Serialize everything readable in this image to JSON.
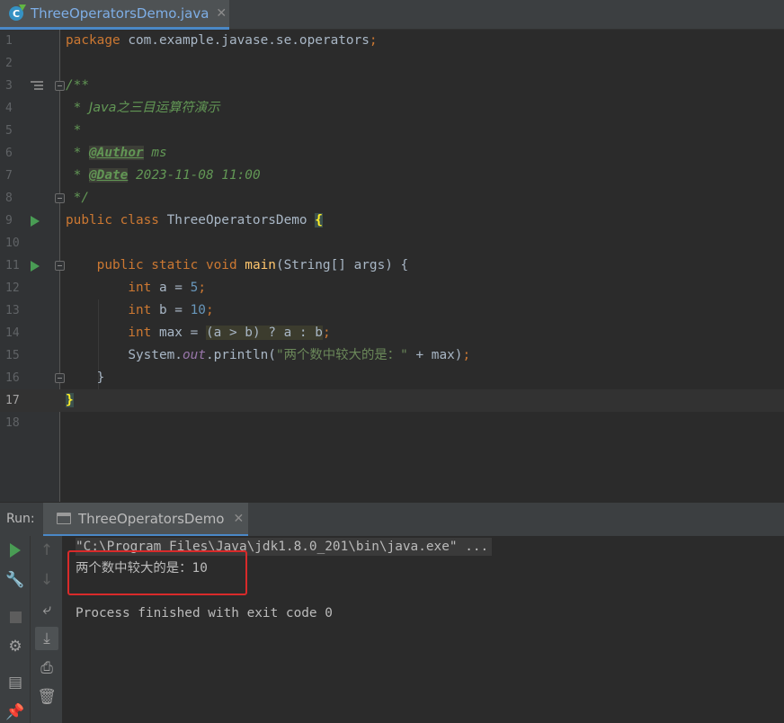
{
  "editor": {
    "tab": {
      "title": "ThreeOperatorsDemo.java",
      "icon": "java-class-icon",
      "close": "✕"
    },
    "current_line": 17,
    "lines": [
      {
        "n": "1"
      },
      {
        "n": "2"
      },
      {
        "n": "3"
      },
      {
        "n": "4"
      },
      {
        "n": "5"
      },
      {
        "n": "6"
      },
      {
        "n": "7"
      },
      {
        "n": "8"
      },
      {
        "n": "9"
      },
      {
        "n": "10"
      },
      {
        "n": "11"
      },
      {
        "n": "12"
      },
      {
        "n": "13"
      },
      {
        "n": "14"
      },
      {
        "n": "15"
      },
      {
        "n": "16"
      },
      {
        "n": "17"
      },
      {
        "n": "18"
      }
    ],
    "code": {
      "l1_kw": "package",
      "l1_rest": " com.example.javase.se.operators",
      "l1_semi": ";",
      "l3": "/**",
      "l4_star": " * ",
      "l4_text": "Java之三目运算符演示",
      "l5": " *",
      "l6_star": " * ",
      "l6_tag": "@Author",
      "l6_val": " ms",
      "l7_star": " * ",
      "l7_tag": "@Date",
      "l7_val": " 2023-11-08 11:00",
      "l8": " */",
      "l9_kw": "public class",
      "l9_name": " ThreeOperatorsDemo ",
      "l9_brace": "{",
      "l11_indent": "    ",
      "l11_kw": "public static void",
      "l11_sp": " ",
      "l11_fn": "main",
      "l11_rest": "(String[] args) {",
      "l12_indent": "        ",
      "l12_kw": "int",
      "l12_rest": " a = ",
      "l12_num": "5",
      "l12_semi": ";",
      "l13_indent": "        ",
      "l13_kw": "int",
      "l13_rest": " b = ",
      "l13_num": "10",
      "l13_semi": ";",
      "l14_indent": "        ",
      "l14_kw": "int",
      "l14_rest": " max = ",
      "l14_expr": "(a > b) ? a : b",
      "l14_semi": ";",
      "l15_indent": "        ",
      "l15_pre": "System.",
      "l15_field": "out",
      "l15_mid": ".println(",
      "l15_str": "\"两个数中较大的是：\"",
      "l15_post": " + max)",
      "l15_semi": ";",
      "l16": "    }",
      "l17_brace": "}"
    }
  },
  "run_panel": {
    "label": "Run:",
    "tab_title": "ThreeOperatorsDemo",
    "tab_close": "✕",
    "output": {
      "command": "\"C:\\Program Files\\Java\\jdk1.8.0_201\\bin\\java.exe\" ...",
      "result_prefix": "两个数中较大的是：",
      "result_value": "10",
      "exit": "Process finished with exit code 0"
    },
    "toolbar": [
      "rerun-icon",
      "wrench-icon",
      "stop-icon",
      "settings-icon",
      "layout-icon",
      "pin-icon",
      "up-arrow-icon",
      "down-arrow-icon",
      "soft-wrap-icon",
      "scroll-to-end-icon",
      "print-icon",
      "trash-icon"
    ],
    "colors": {
      "highlight_box": "#d82a2a",
      "run_green": "#499c54",
      "accent": "#4a88c7"
    }
  }
}
